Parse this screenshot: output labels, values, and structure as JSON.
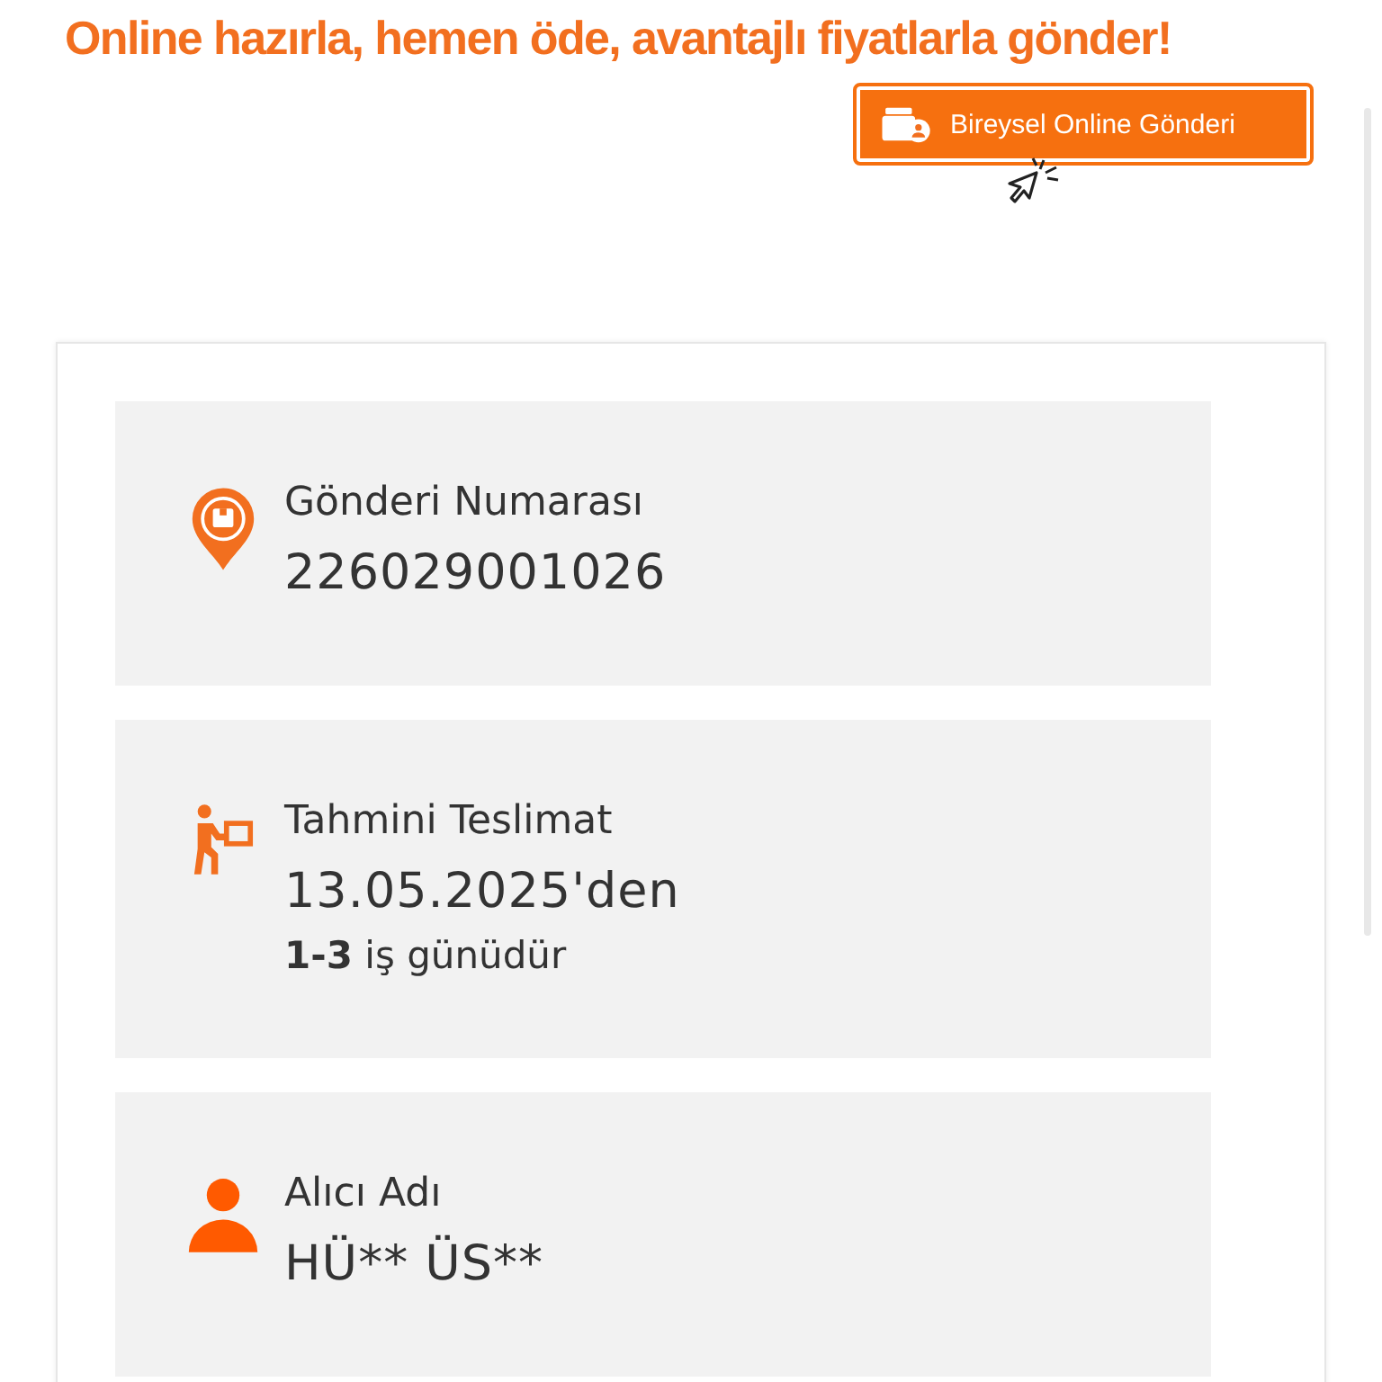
{
  "headline": "Online hazırla, hemen öde, avantajlı fiyatlarla gönder!",
  "cta_button": {
    "label": "Bireysel Online Gönderi"
  },
  "info_panels": [
    {
      "kind": "pin",
      "label": "Gönderi Numarası",
      "value": "226029001026"
    },
    {
      "kind": "courier",
      "label": "Tahmini Teslimat",
      "value": "13.05.2025'den",
      "note": "**1-3** iş günüdür"
    },
    {
      "kind": "person",
      "label": "Alıcı Adı",
      "value": "HÜ** ÜS**"
    }
  ]
}
